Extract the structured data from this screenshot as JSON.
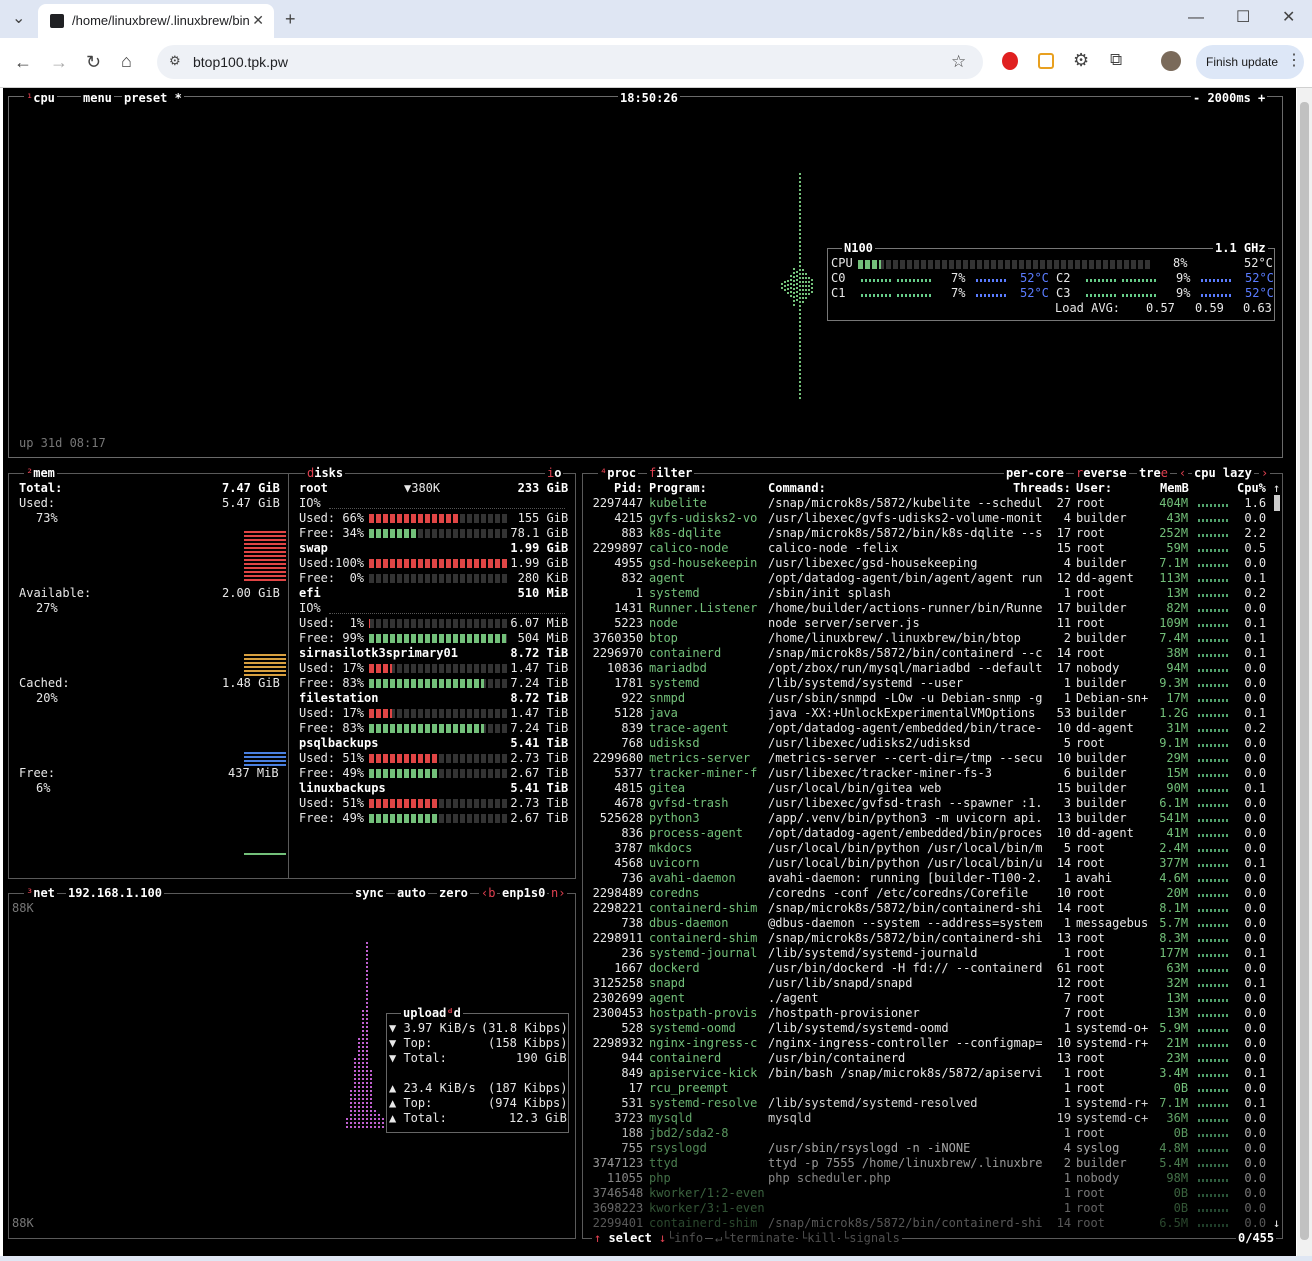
{
  "browser": {
    "tab_title": "/home/linuxbrew/.linuxbrew/bin",
    "url": "btop100.tpk.pw",
    "finish_update": "Finish update"
  },
  "cpu": {
    "title": "cpu",
    "menu": "menu",
    "preset": "preset *",
    "time": "18:50:26",
    "interval": "- 2000ms +",
    "uptime": "up 31d 08:17",
    "model": "N100",
    "freq": "1.1 GHz",
    "total_label": "CPU",
    "total_pct": "8%",
    "total_temp": "52°C",
    "total_value": 8,
    "cores": [
      {
        "name": "C0",
        "pct": "7%",
        "temp": "52°C"
      },
      {
        "name": "C1",
        "pct": "7%",
        "temp": "52°C"
      },
      {
        "name": "C2",
        "pct": "9%",
        "temp": "52°C"
      },
      {
        "name": "C3",
        "pct": "9%",
        "temp": "52°C"
      }
    ],
    "load_label": "Load AVG:",
    "load": [
      "0.57",
      "0.59",
      "0.63"
    ]
  },
  "mem": {
    "title": "mem",
    "total_label": "Total:",
    "total": "7.47 GiB",
    "used_label": "Used:",
    "used": "5.47 GiB",
    "used_pct": "73%",
    "avail_label": "Available:",
    "avail": "2.00 GiB",
    "avail_pct": "27%",
    "cached_label": "Cached:",
    "cached": "1.48 GiB",
    "cached_pct": "20%",
    "free_label": "Free:",
    "free": "437 MiB",
    "free_pct": "6%"
  },
  "disks": {
    "title": "disks",
    "io": "io",
    "items": [
      {
        "name": "root",
        "io_speed": "▼380K",
        "size": "233 GiB",
        "io": "IO%",
        "used_label": "Used: 66%",
        "used": "155 GiB",
        "used_value": 66,
        "free_label": "Free: 34%",
        "free": "78.1 GiB",
        "free_value": 34
      },
      {
        "name": "swap",
        "size": "1.99 GiB",
        "used_label": "Used:100%",
        "used": "1.99 GiB",
        "used_value": 100,
        "free_label": "Free:  0%",
        "free": "280 KiB",
        "free_value": 0
      },
      {
        "name": "efi",
        "size": "510 MiB",
        "io": "IO%",
        "used_label": "Used:  1%",
        "used": "6.07 MiB",
        "used_value": 1,
        "free_label": "Free: 99%",
        "free": "504 MiB",
        "free_value": 99
      },
      {
        "name": "sirnasilotk3sprimary01",
        "size": "8.72 TiB",
        "used_label": "Used: 17%",
        "used": "1.47 TiB",
        "used_value": 17,
        "free_label": "Free: 83%",
        "free": "7.24 TiB",
        "free_value": 83
      },
      {
        "name": "filestation",
        "size": "8.72 TiB",
        "used_label": "Used: 17%",
        "used": "1.47 TiB",
        "used_value": 17,
        "free_label": "Free: 83%",
        "free": "7.24 TiB",
        "free_value": 83
      },
      {
        "name": "psqlbackups",
        "size": "5.41 TiB",
        "used_label": "Used: 51%",
        "used": "2.73 TiB",
        "used_value": 51,
        "free_label": "Free: 49%",
        "free": "2.67 TiB",
        "free_value": 49
      },
      {
        "name": "linuxbackups",
        "size": "5.41 TiB",
        "used_label": "Used: 51%",
        "used": "2.73 TiB",
        "used_value": 51,
        "free_label": "Free: 49%",
        "free": "2.67 TiB",
        "free_value": 49
      }
    ]
  },
  "net": {
    "title": "net",
    "ip": "192.168.1.100",
    "sync": "sync",
    "auto": "auto",
    "zero": "zero",
    "prev": "‹b",
    "iface": "enp1s0",
    "next": "n›",
    "scale_top": "88K",
    "scale_bottom": "88K",
    "panel_title": "upload",
    "panel_title_extra": "d",
    "download": {
      "rate": "▼ 3.97 KiB/s",
      "rate_bits": "(31.8 Kibps)",
      "top_label": "▼ Top:",
      "top": "(158 Kibps)",
      "total_label": "▼ Total:",
      "total": "190 GiB"
    },
    "upload": {
      "rate": "▲ 23.4 KiB/s",
      "rate_bits": "(187 Kibps)",
      "top_label": "▲ Top:",
      "top": "(974 Kibps)",
      "total_label": "▲ Total:",
      "total": "12.3 GiB"
    }
  },
  "proc": {
    "title": "proc",
    "filter": "filter",
    "per_core": "per-core",
    "reverse": "reverse",
    "tree": "tree",
    "sort_prev": "‹",
    "sort": "cpu lazy",
    "sort_next": "›",
    "headers": {
      "pid": "Pid:",
      "program": "Program:",
      "command": "Command:",
      "threads": "Threads:",
      "user": "User:",
      "mem": "MemB",
      "cpu": "Cpu%"
    },
    "footer": {
      "select": "↑ select ↓",
      "info": "info",
      "terminate": "terminate",
      "kill": "kill",
      "signals": "signals",
      "count": "0/455"
    },
    "rows": [
      [
        "2297447",
        "kubelite",
        "/snap/microk8s/5872/kubelite --schedul",
        "27",
        "root",
        "404M",
        "1.6"
      ],
      [
        "4215",
        "gvfs-udisks2-vo",
        "/usr/libexec/gvfs-udisks2-volume-monit",
        "4",
        "builder",
        "43M",
        "0.0"
      ],
      [
        "883",
        "k8s-dqlite",
        "/snap/microk8s/5872/bin/k8s-dqlite --s",
        "17",
        "root",
        "252M",
        "2.2"
      ],
      [
        "2299897",
        "calico-node",
        "calico-node -felix",
        "15",
        "root",
        "59M",
        "0.5"
      ],
      [
        "4955",
        "gsd-housekeepin",
        "/usr/libexec/gsd-housekeeping",
        "4",
        "builder",
        "7.1M",
        "0.0"
      ],
      [
        "832",
        "agent",
        "/opt/datadog-agent/bin/agent/agent run",
        "12",
        "dd-agent",
        "113M",
        "0.1"
      ],
      [
        "1",
        "systemd",
        "/sbin/init splash",
        "1",
        "root",
        "13M",
        "0.2"
      ],
      [
        "1431",
        "Runner.Listener",
        "/home/builder/actions-runner/bin/Runne",
        "17",
        "builder",
        "82M",
        "0.0"
      ],
      [
        "5223",
        "node",
        "node server/server.js",
        "11",
        "root",
        "109M",
        "0.1"
      ],
      [
        "3760350",
        "btop",
        "/home/linuxbrew/.linuxbrew/bin/btop",
        "2",
        "builder",
        "7.4M",
        "0.1"
      ],
      [
        "2296970",
        "containerd",
        "/snap/microk8s/5872/bin/containerd --c",
        "14",
        "root",
        "38M",
        "0.1"
      ],
      [
        "10836",
        "mariadbd",
        "/opt/zbox/run/mysql/mariadbd --default",
        "17",
        "nobody",
        "94M",
        "0.0"
      ],
      [
        "1781",
        "systemd",
        "/lib/systemd/systemd --user",
        "1",
        "builder",
        "9.3M",
        "0.0"
      ],
      [
        "922",
        "snmpd",
        "/usr/sbin/snmpd -LOw -u Debian-snmp -g",
        "1",
        "Debian-sn+",
        "17M",
        "0.0"
      ],
      [
        "5128",
        "java",
        "java -XX:+UnlockExperimentalVMOptions",
        "53",
        "builder",
        "1.2G",
        "0.1"
      ],
      [
        "839",
        "trace-agent",
        "/opt/datadog-agent/embedded/bin/trace-",
        "10",
        "dd-agent",
        "31M",
        "0.2"
      ],
      [
        "768",
        "udisksd",
        "/usr/libexec/udisks2/udisksd",
        "5",
        "root",
        "9.1M",
        "0.0"
      ],
      [
        "2299680",
        "metrics-server",
        "/metrics-server --cert-dir=/tmp --secu",
        "10",
        "builder",
        "29M",
        "0.0"
      ],
      [
        "5377",
        "tracker-miner-f",
        "/usr/libexec/tracker-miner-fs-3",
        "6",
        "builder",
        "15M",
        "0.0"
      ],
      [
        "4815",
        "gitea",
        "/usr/local/bin/gitea web",
        "15",
        "builder",
        "90M",
        "0.1"
      ],
      [
        "4678",
        "gvfsd-trash",
        "/usr/libexec/gvfsd-trash --spawner :1.",
        "3",
        "builder",
        "6.1M",
        "0.0"
      ],
      [
        "525628",
        "python3",
        "/app/.venv/bin/python3 -m uvicorn api.",
        "13",
        "builder",
        "541M",
        "0.0"
      ],
      [
        "836",
        "process-agent",
        "/opt/datadog-agent/embedded/bin/proces",
        "10",
        "dd-agent",
        "41M",
        "0.0"
      ],
      [
        "3787",
        "mkdocs",
        "/usr/local/bin/python /usr/local/bin/m",
        "5",
        "root",
        "2.4M",
        "0.0"
      ],
      [
        "4568",
        "uvicorn",
        "/usr/local/bin/python /usr/local/bin/u",
        "14",
        "root",
        "377M",
        "0.1"
      ],
      [
        "736",
        "avahi-daemon",
        "avahi-daemon: running [builder-T100-2.",
        "1",
        "avahi",
        "4.6M",
        "0.0"
      ],
      [
        "2298489",
        "coredns",
        "/coredns -conf /etc/coredns/Corefile",
        "10",
        "root",
        "20M",
        "0.0"
      ],
      [
        "2298221",
        "containerd-shim",
        "/snap/microk8s/5872/bin/containerd-shi",
        "14",
        "root",
        "8.1M",
        "0.0"
      ],
      [
        "738",
        "dbus-daemon",
        "@dbus-daemon --system --address=system",
        "1",
        "messagebus",
        "5.7M",
        "0.0"
      ],
      [
        "2298911",
        "containerd-shim",
        "/snap/microk8s/5872/bin/containerd-shi",
        "13",
        "root",
        "8.3M",
        "0.0"
      ],
      [
        "236",
        "systemd-journal",
        "/lib/systemd/systemd-journald",
        "1",
        "root",
        "177M",
        "0.1"
      ],
      [
        "1667",
        "dockerd",
        "/usr/bin/dockerd -H fd:// --containerd",
        "61",
        "root",
        "63M",
        "0.0"
      ],
      [
        "3125258",
        "snapd",
        "/usr/lib/snapd/snapd",
        "12",
        "root",
        "32M",
        "0.1"
      ],
      [
        "2302699",
        "agent",
        "./agent",
        "7",
        "root",
        "13M",
        "0.0"
      ],
      [
        "2300453",
        "hostpath-provis",
        "/hostpath-provisioner",
        "7",
        "root",
        "13M",
        "0.0"
      ],
      [
        "528",
        "systemd-oomd",
        "/lib/systemd/systemd-oomd",
        "1",
        "systemd-o+",
        "5.9M",
        "0.0"
      ],
      [
        "2298932",
        "nginx-ingress-c",
        "/nginx-ingress-controller --configmap=",
        "10",
        "systemd-r+",
        "21M",
        "0.0"
      ],
      [
        "944",
        "containerd",
        "/usr/bin/containerd",
        "13",
        "root",
        "23M",
        "0.0"
      ],
      [
        "849",
        "apiservice-kick",
        "/bin/bash /snap/microk8s/5872/apiservi",
        "1",
        "root",
        "3.4M",
        "0.1"
      ],
      [
        "17",
        "rcu_preempt",
        "",
        "1",
        "root",
        "0B",
        "0.0"
      ],
      [
        "531",
        "systemd-resolve",
        "/lib/systemd/systemd-resolved",
        "1",
        "systemd-r+",
        "7.1M",
        "0.1"
      ],
      [
        "3723",
        "mysqld",
        "mysqld",
        "19",
        "systemd-c+",
        "36M",
        "0.0"
      ],
      [
        "188",
        "jbd2/sda2-8",
        "",
        "1",
        "root",
        "0B",
        "0.0"
      ],
      [
        "755",
        "rsyslogd",
        "/usr/sbin/rsyslogd -n -iNONE",
        "4",
        "syslog",
        "4.8M",
        "0.0"
      ],
      [
        "3747123",
        "ttyd",
        "ttyd -p 7555 /home/linuxbrew/.linuxbre",
        "2",
        "builder",
        "5.4M",
        "0.0"
      ],
      [
        "11055",
        "php",
        "php scheduler.php",
        "1",
        "nobody",
        "98M",
        "0.0"
      ],
      [
        "3746548",
        "kworker/1:2-even",
        "",
        "1",
        "root",
        "0B",
        "0.0"
      ],
      [
        "3698223",
        "kworker/3:1-even",
        "",
        "1",
        "root",
        "0B",
        "0.0"
      ],
      [
        "2299401",
        "containerd-shim",
        "/snap/microk8s/5872/bin/containerd-shi",
        "14",
        "root",
        "6.5M",
        "0.0"
      ]
    ]
  }
}
